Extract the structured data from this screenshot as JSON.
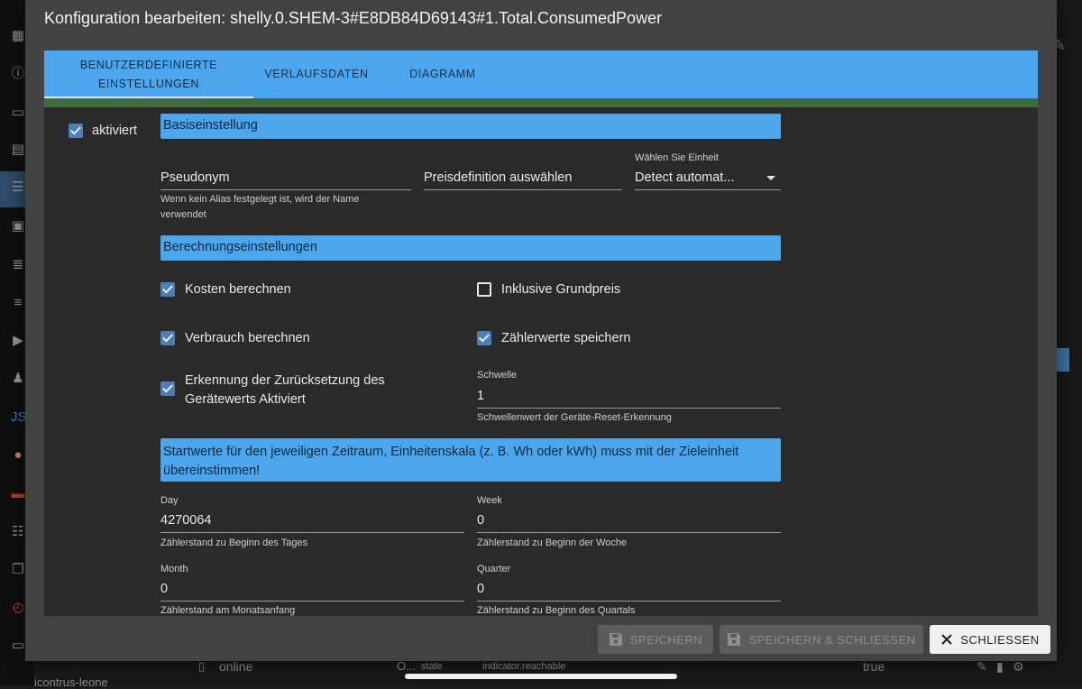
{
  "dialog": {
    "title": "Konfiguration bearbeiten: shelly.0.SHEM-3#E8DB84D69143#1.Total.ConsumedPower"
  },
  "tabs": [
    {
      "label_line1": "BENUTZERDEFINIERTE",
      "label_line2": "EINSTELLUNGEN"
    },
    {
      "label": "VERLAUFSDATEN"
    },
    {
      "label": "DIAGRAMM"
    }
  ],
  "enabled": {
    "label": "aktiviert",
    "checked": true
  },
  "basic": {
    "header": "Basiseinstellung",
    "alias": {
      "value": "Pseudonym",
      "helper_line1": "Wenn kein Alias festgelegt ist, wird der Name",
      "helper_line2": "verwendet"
    },
    "price": {
      "value": "Preisdefinition auswählen"
    },
    "unit": {
      "label": "Wählen Sie Einheit",
      "value": "Detect automat..."
    }
  },
  "calc": {
    "header": "Berechnungseinstellungen",
    "costs": {
      "label": "Kosten berechnen",
      "checked": true
    },
    "base_price": {
      "label": "Inklusive Grundpreis",
      "checked": false
    },
    "consumption": {
      "label": "Verbrauch berechnen",
      "checked": true
    },
    "meter_values": {
      "label": "Zählerwerte speichern",
      "checked": true
    },
    "reset_detection": {
      "label_line1": "Erkennung der Zurücksetzung des",
      "label_line2": "Gerätewerts Aktiviert",
      "checked": true
    },
    "threshold": {
      "label": "Schwelle",
      "value": "1",
      "helper": "Schwellenwert der Geräte-Reset-Erkennung"
    }
  },
  "start": {
    "header_line1": "Startwerte für den jeweiligen Zeitraum, Einheitenskala (z. B. Wh oder kWh) muss mit der Zieleinheit",
    "header_line2": "übereinstimmen!",
    "day": {
      "label": "Day",
      "value": "4270064",
      "helper": "Zählerstand zu Beginn des Tages"
    },
    "week": {
      "label": "Week",
      "value": "0",
      "helper": "Zählerstand zu Beginn der Woche"
    },
    "month": {
      "label": "Month",
      "value": "0",
      "helper": "Zählerstand am Monatsanfang"
    },
    "quarter": {
      "label": "Quarter",
      "value": "0",
      "helper": "Zählerstand zu Beginn des Quartals"
    }
  },
  "footer": {
    "save": "SPEICHERN",
    "save_close": "SPEICHERN & SCHLIESSEN",
    "close": "SCHLIESSEN"
  },
  "background": {
    "row_name": "online",
    "row_col2": "O...",
    "row_col3": "state",
    "row_col4": "indicator.reachable",
    "row_value": "true",
    "bottom_text": "icontrus-leone"
  },
  "colors": {
    "accent": "#4ba6ee",
    "checkbox": "#4c7fb5",
    "dialog_bg": "#424242",
    "content_bg": "#2a2a2a"
  }
}
